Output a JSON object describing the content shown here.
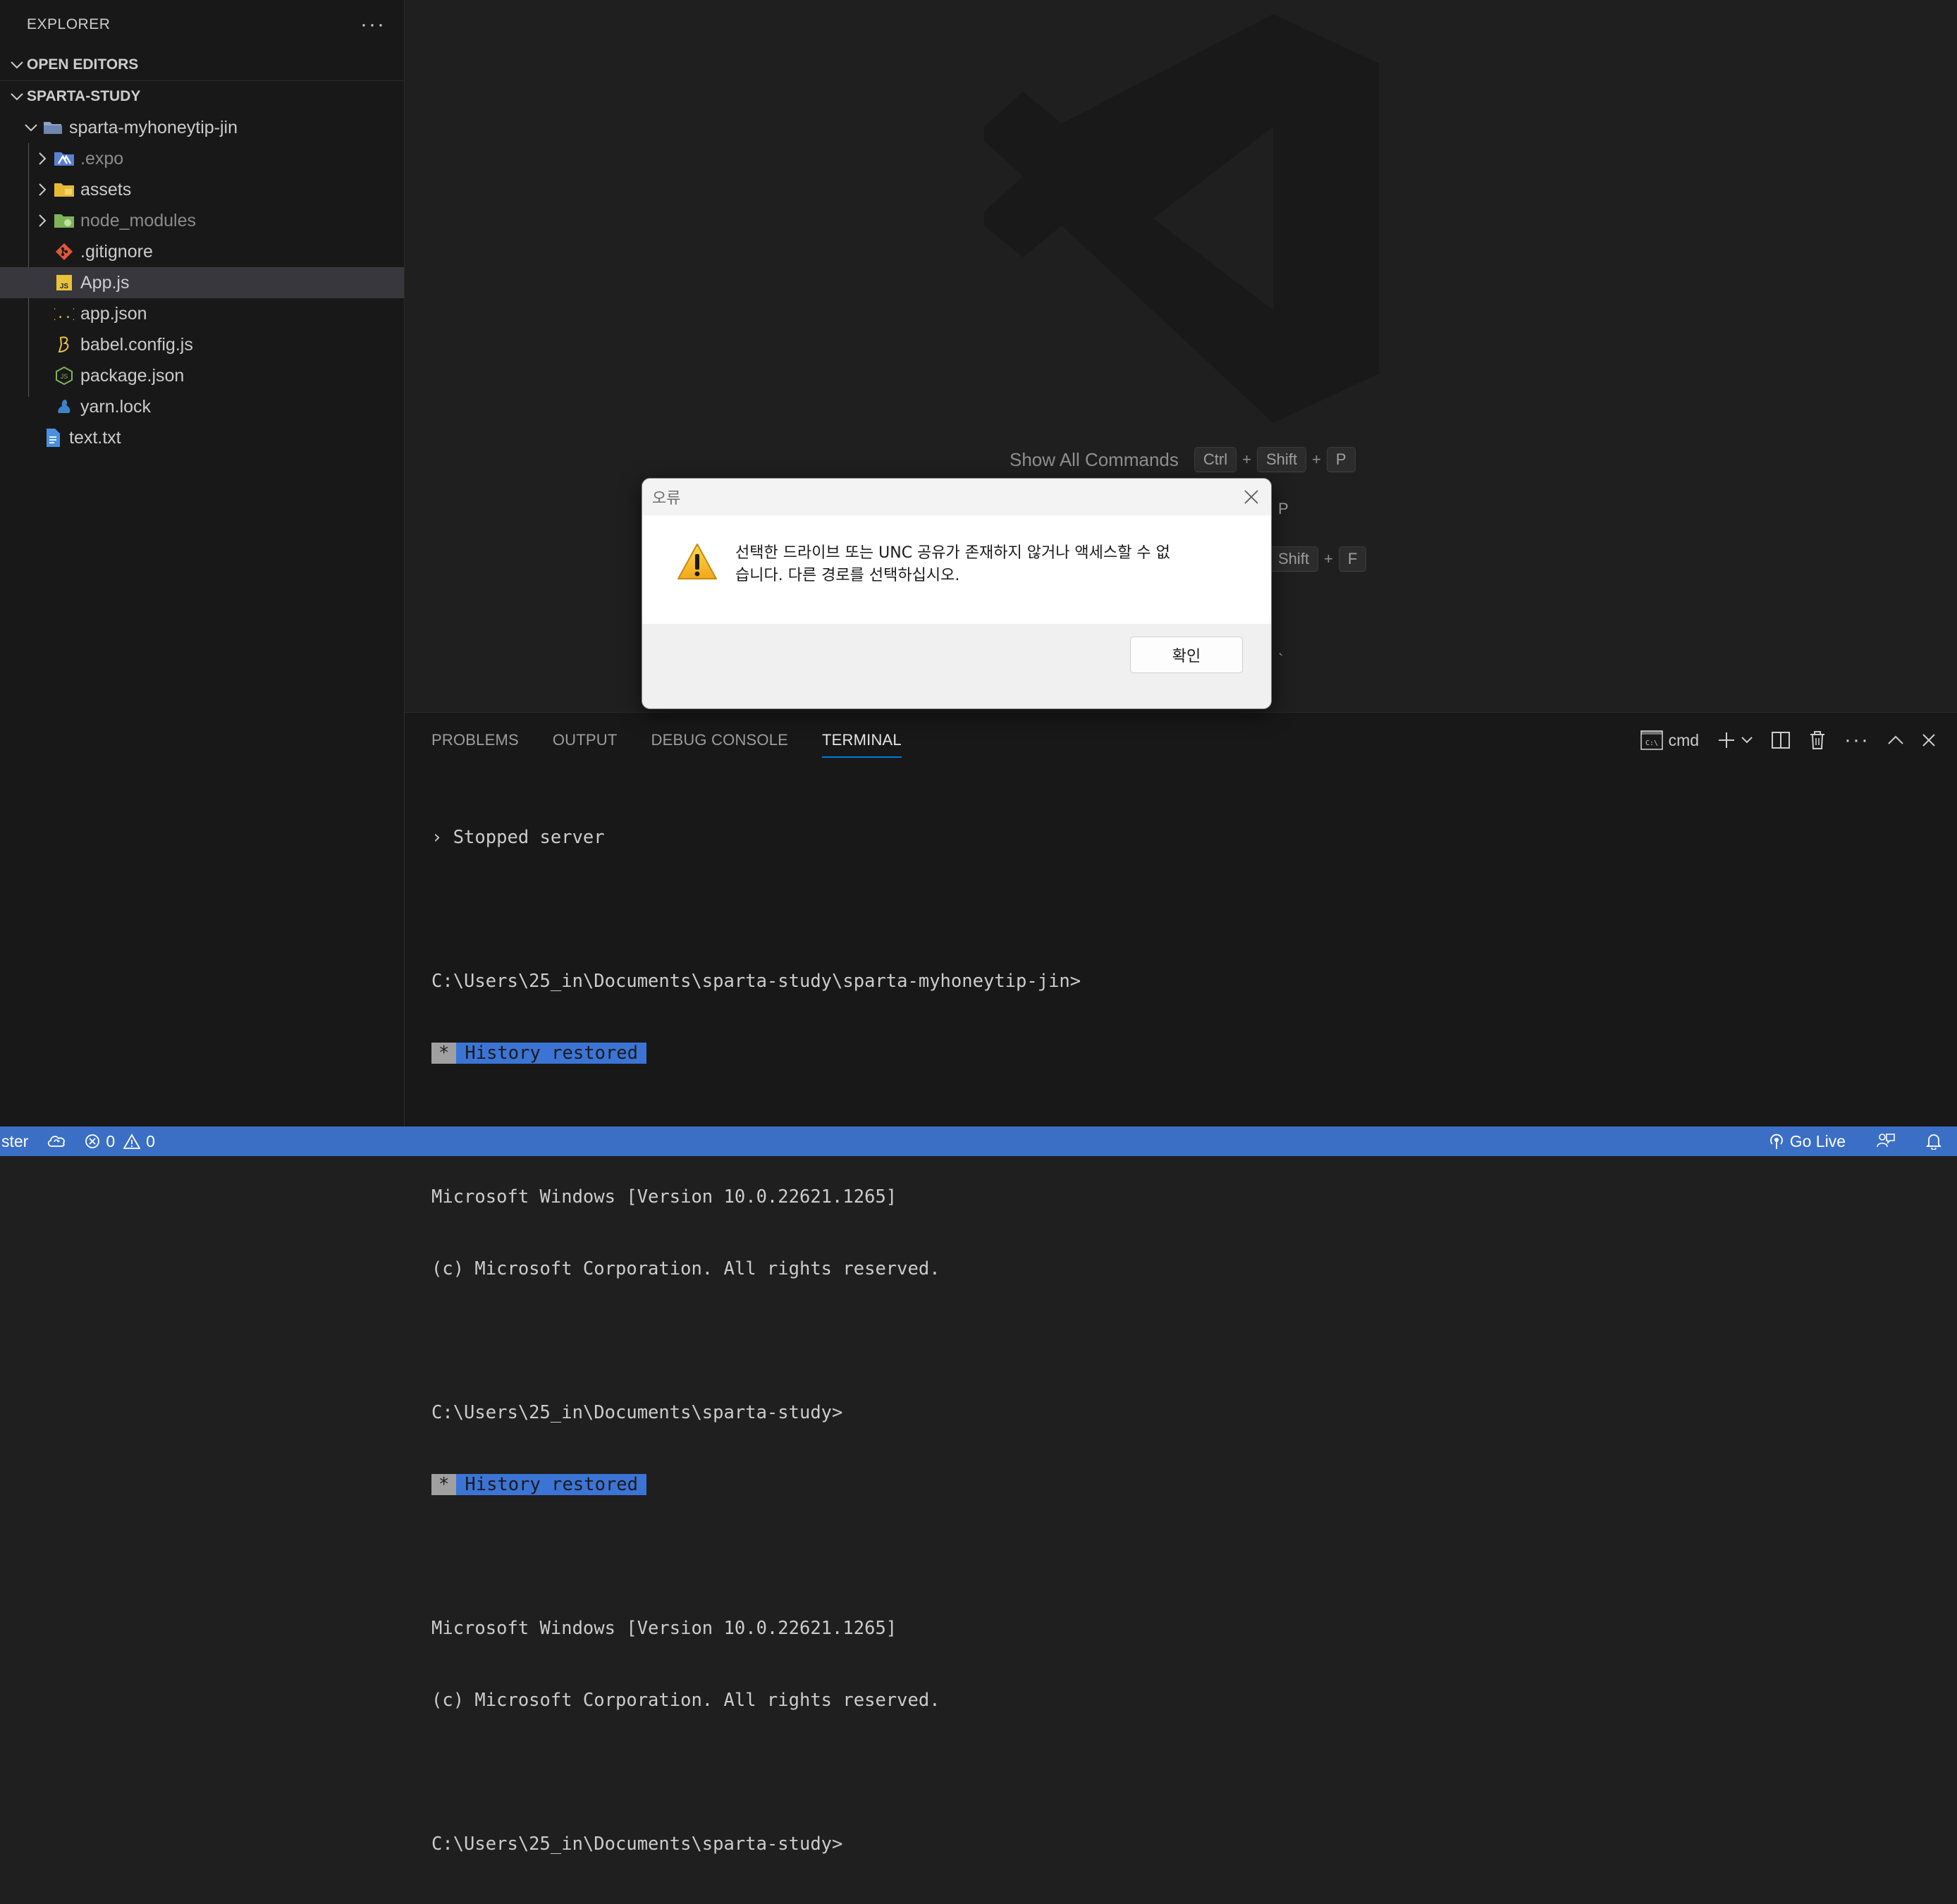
{
  "sidebar": {
    "title": "EXPLORER",
    "more": "···",
    "open_editors": "OPEN EDITORS",
    "workspace": "SPARTA-STUDY",
    "root_folder": "sparta-myhoneytip-jin",
    "items": [
      {
        "label": ".expo",
        "icon": "expo-folder-icon",
        "dim": true
      },
      {
        "label": "assets",
        "icon": "assets-folder-icon",
        "dim": false
      },
      {
        "label": "node_modules",
        "icon": "node-modules-folder-icon",
        "dim": true
      },
      {
        "label": ".gitignore",
        "icon": "git-icon",
        "dim": false
      },
      {
        "label": "App.js",
        "icon": "js-icon",
        "dim": false
      },
      {
        "label": "app.json",
        "icon": "json-icon",
        "dim": false
      },
      {
        "label": "babel.config.js",
        "icon": "babel-icon",
        "dim": false
      },
      {
        "label": "package.json",
        "icon": "nodejs-icon",
        "dim": false
      },
      {
        "label": "yarn.lock",
        "icon": "yarn-icon",
        "dim": false
      }
    ],
    "root_file": "text.txt"
  },
  "editor": {
    "show_all_commands": "Show All Commands",
    "keys_ctrl": "Ctrl",
    "keys_shift": "Shift",
    "keys_p": "P",
    "keys_f": "F",
    "row2_tail": "P",
    "row3_shift": "Shift",
    "row3_key": "F",
    "row4_tail": "`",
    "plus": "+"
  },
  "panel": {
    "tabs": [
      "PROBLEMS",
      "OUTPUT",
      "DEBUG CONSOLE",
      "TERMINAL"
    ],
    "active_tab": "TERMINAL",
    "terminal_name": "cmd",
    "terminal_icon_text": "C:\\",
    "lines": {
      "l1": "› Stopped server",
      "l2": "C:\\Users\\25_in\\Documents\\sparta-study\\sparta-myhoneytip-jin>",
      "star": "*",
      "history": "History restored",
      "l3": "Microsoft Windows [Version 10.0.22621.1265]",
      "l4": "(c) Microsoft Corporation. All rights reserved.",
      "l5": "C:\\Users\\25_in\\Documents\\sparta-study>",
      "l6": "Microsoft Windows [Version 10.0.22621.1265]",
      "l7": "(c) Microsoft Corporation. All rights reserved.",
      "l8": "C:\\Users\\25_in\\Documents\\sparta-study>"
    }
  },
  "statusbar": {
    "branch": "ster",
    "errors": "0",
    "warnings": "0",
    "go_live": "Go Live",
    "colors": {
      "background": "#3b6fc6"
    }
  },
  "dialog": {
    "title": "오류",
    "message": "선택한 드라이브 또는 UNC 공유가 존재하지 않거나 액세스할 수 없\n습니다. 다른 경로를 선택하십시오.",
    "ok": "확인"
  }
}
